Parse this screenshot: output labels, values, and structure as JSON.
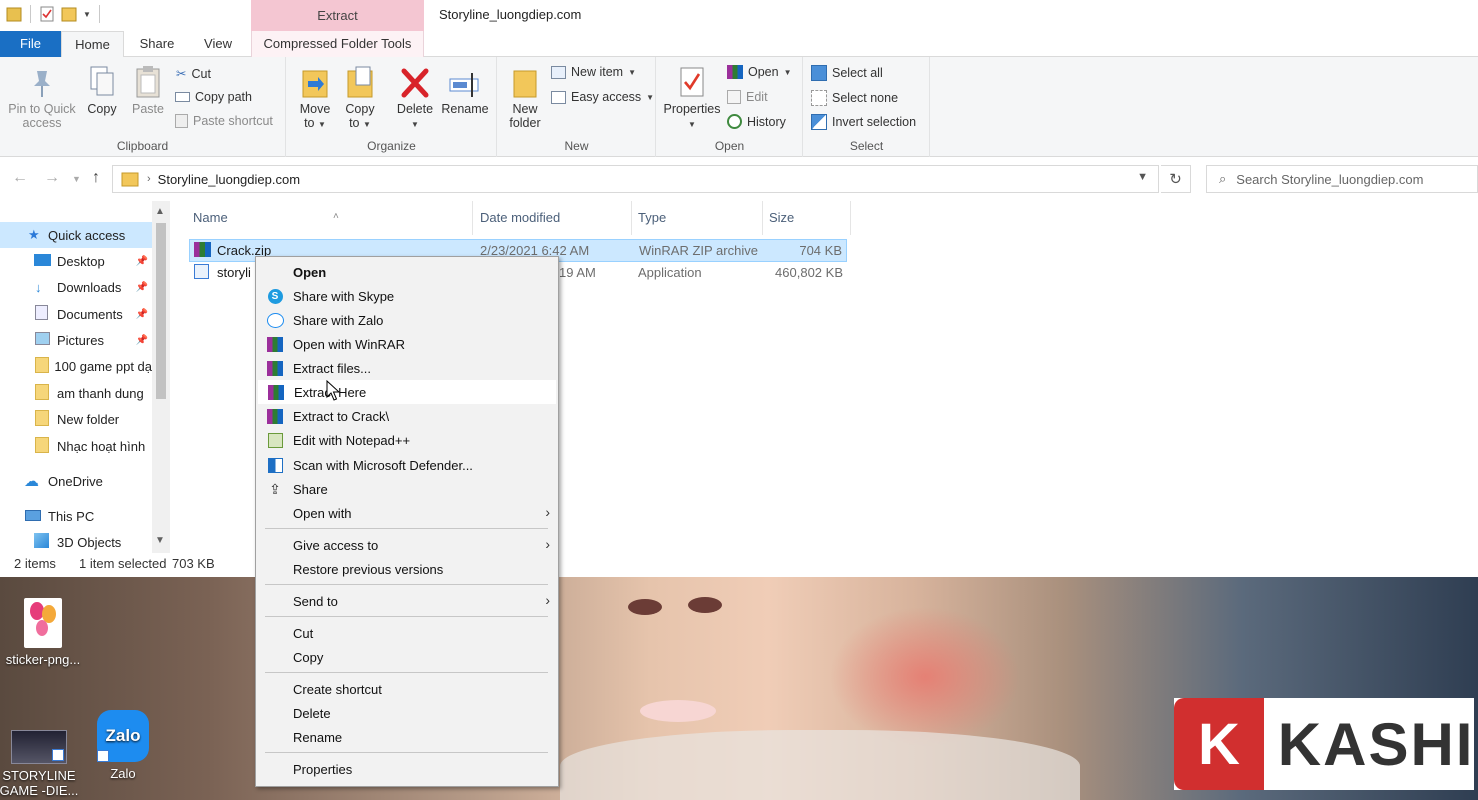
{
  "window": {
    "title": "Storyline_luongdiep.com",
    "context_tab_group": "Extract"
  },
  "tabs": {
    "file": "File",
    "home": "Home",
    "share": "Share",
    "view": "View",
    "compressed": "Compressed Folder Tools"
  },
  "ribbon": {
    "clipboard": {
      "label": "Clipboard",
      "pin": "Pin to Quick access",
      "pin_l1": "Pin to Quick",
      "pin_l2": "access",
      "copy": "Copy",
      "paste": "Paste",
      "cut": "Cut",
      "copy_path": "Copy path",
      "paste_shortcut": "Paste shortcut"
    },
    "organize": {
      "label": "Organize",
      "move_l1": "Move",
      "move_l2": "to",
      "copy_l1": "Copy",
      "copy_l2": "to",
      "delete": "Delete",
      "rename": "Rename"
    },
    "new": {
      "label": "New",
      "folder_l1": "New",
      "folder_l2": "folder",
      "new_item": "New item",
      "easy_access": "Easy access"
    },
    "open": {
      "label": "Open",
      "properties": "Properties",
      "open": "Open",
      "edit": "Edit",
      "history": "History"
    },
    "select": {
      "label": "Select",
      "all": "Select all",
      "none": "Select none",
      "invert": "Invert selection"
    }
  },
  "address": {
    "path": "Storyline_luongdiep.com",
    "search_placeholder": "Search Storyline_luongdiep.com"
  },
  "nav": {
    "items": [
      {
        "label": "Quick access"
      },
      {
        "label": "Desktop"
      },
      {
        "label": "Downloads"
      },
      {
        "label": "Documents"
      },
      {
        "label": "Pictures"
      },
      {
        "label": "100 game ppt dạ"
      },
      {
        "label": "am thanh dung"
      },
      {
        "label": "New folder"
      },
      {
        "label": "Nhạc hoạt hình"
      },
      {
        "label": "OneDrive"
      },
      {
        "label": "This PC"
      },
      {
        "label": "3D Objects"
      }
    ]
  },
  "columns": {
    "name": "Name",
    "date": "Date modified",
    "type": "Type",
    "size": "Size"
  },
  "files": [
    {
      "name": "Crack.zip",
      "date": "2/23/2021 6:42 AM",
      "type": "WinRAR ZIP archive",
      "size": "704 KB"
    },
    {
      "name": "storyli",
      "date": "19 AM",
      "type": "Application",
      "size": "460,802 KB"
    }
  ],
  "status": {
    "count": "2 items",
    "selected": "1 item selected",
    "size": "703 KB"
  },
  "context_menu": {
    "items": [
      {
        "label": "Open"
      },
      {
        "label": "Share with Skype"
      },
      {
        "label": "Share with Zalo"
      },
      {
        "label": "Open with WinRAR"
      },
      {
        "label": "Extract files..."
      },
      {
        "label": "Extract Here"
      },
      {
        "label": "Extract to Crack\\"
      },
      {
        "label": "Edit with Notepad++"
      },
      {
        "label": "Scan with Microsoft Defender..."
      },
      {
        "label": "Share"
      },
      {
        "label": "Open with"
      },
      {
        "label": "Give access to"
      },
      {
        "label": "Restore previous versions"
      },
      {
        "label": "Send to"
      },
      {
        "label": "Cut"
      },
      {
        "label": "Copy"
      },
      {
        "label": "Create shortcut"
      },
      {
        "label": "Delete"
      },
      {
        "label": "Rename"
      },
      {
        "label": "Properties"
      }
    ]
  },
  "desktop": {
    "icons": [
      {
        "label": "sticker-png..."
      },
      {
        "label": "STORYLINE GAME -DIE..."
      },
      {
        "label": "Zalo"
      }
    ],
    "zalo_logo": "Zalo",
    "watermark_letter": "K",
    "watermark_word": "KASHI"
  },
  "colors": {
    "accent": "#1a6fc4",
    "selection": "#cce8ff",
    "context_tab": "#f4c6d2",
    "watermark_red": "#d12f2f"
  }
}
